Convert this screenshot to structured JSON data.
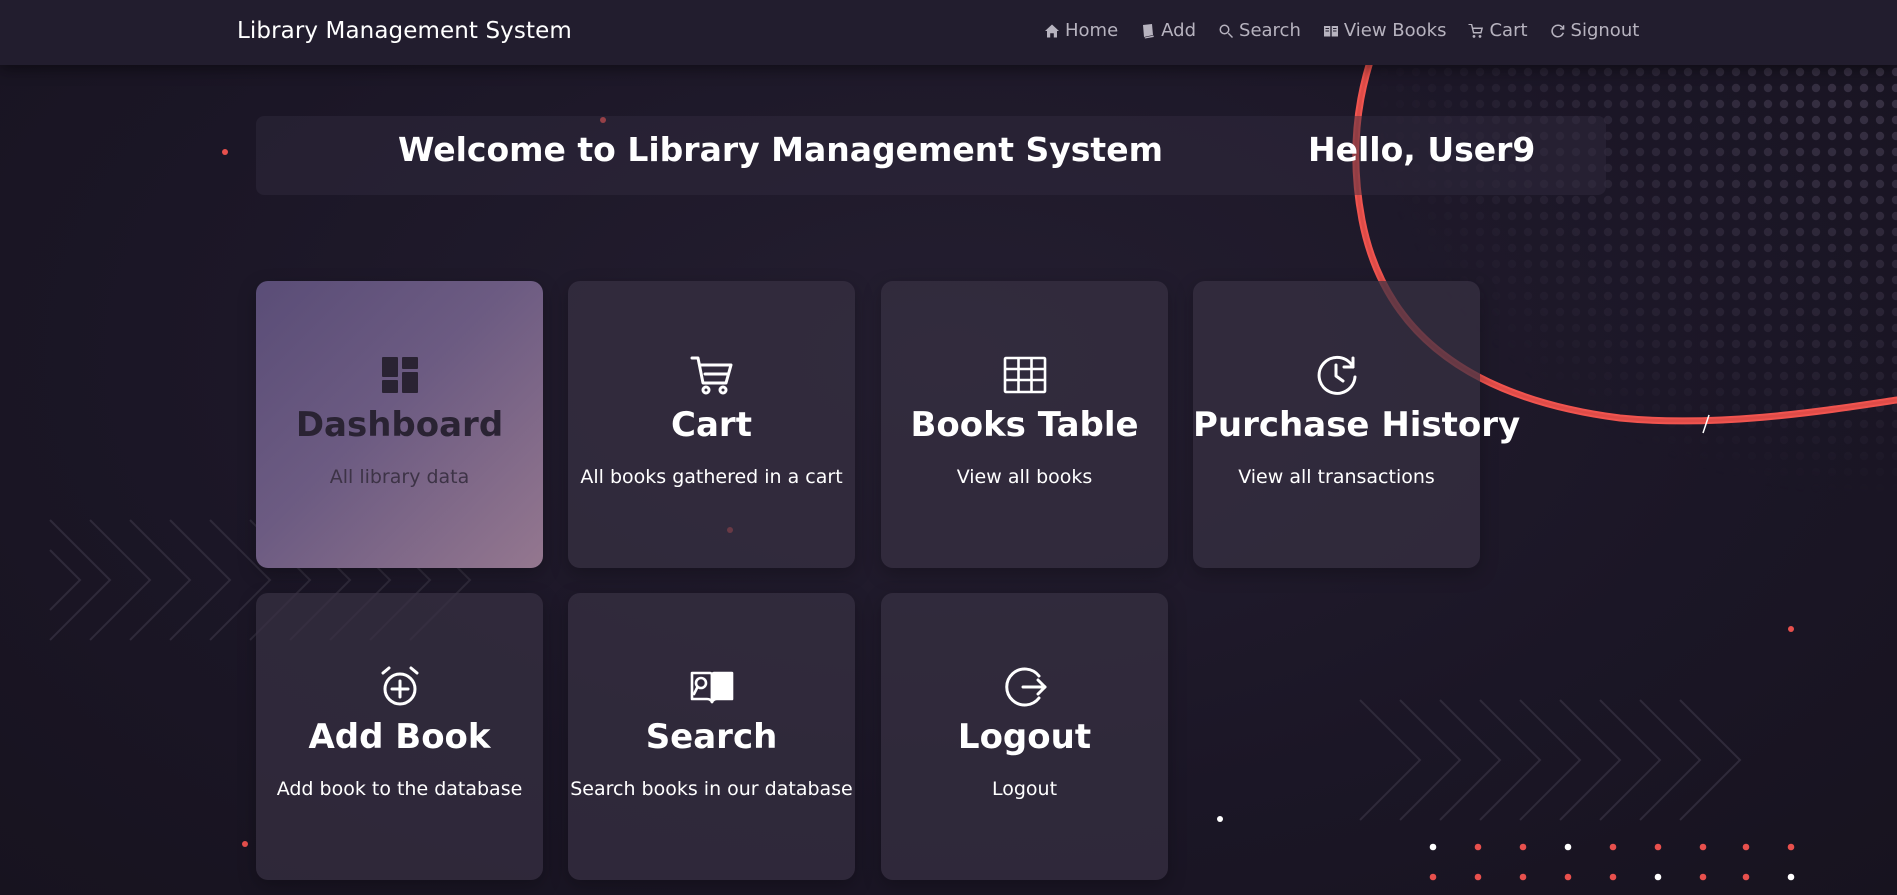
{
  "navbar": {
    "brand": "Library Management System",
    "links": [
      {
        "label": "Home",
        "icon": "home-icon"
      },
      {
        "label": "Add",
        "icon": "book-icon"
      },
      {
        "label": "Search",
        "icon": "search-icon"
      },
      {
        "label": "View Books",
        "icon": "open-book-icon"
      },
      {
        "label": "Cart",
        "icon": "cart-icon"
      },
      {
        "label": "Signout",
        "icon": "signout-icon"
      }
    ]
  },
  "banner": {
    "welcome": "Welcome to Library Management System",
    "greeting": "Hello, User9"
  },
  "cards": [
    {
      "title": "Dashboard",
      "description": "All library data",
      "icon": "dashboard-icon",
      "active": true
    },
    {
      "title": "Cart",
      "description": "All books gathered in a cart",
      "icon": "cart-icon"
    },
    {
      "title": "Books Table",
      "description": "View all books",
      "icon": "table-icon"
    },
    {
      "title": "Purchase History",
      "description": "View all transactions",
      "icon": "history-icon"
    },
    {
      "title": "Add Book",
      "description": "Add book to the database",
      "icon": "add-alarm-icon"
    },
    {
      "title": "Search",
      "description": "Search books in our database",
      "icon": "book-search-icon"
    },
    {
      "title": "Logout",
      "description": "Logout",
      "icon": "logout-icon"
    }
  ],
  "colors": {
    "background": "#1d1828",
    "navbar": "#221d2e",
    "card": "#373042",
    "accent_red": "#f0544f",
    "active_card_start": "#5a4d77",
    "active_card_end": "#94778f"
  }
}
